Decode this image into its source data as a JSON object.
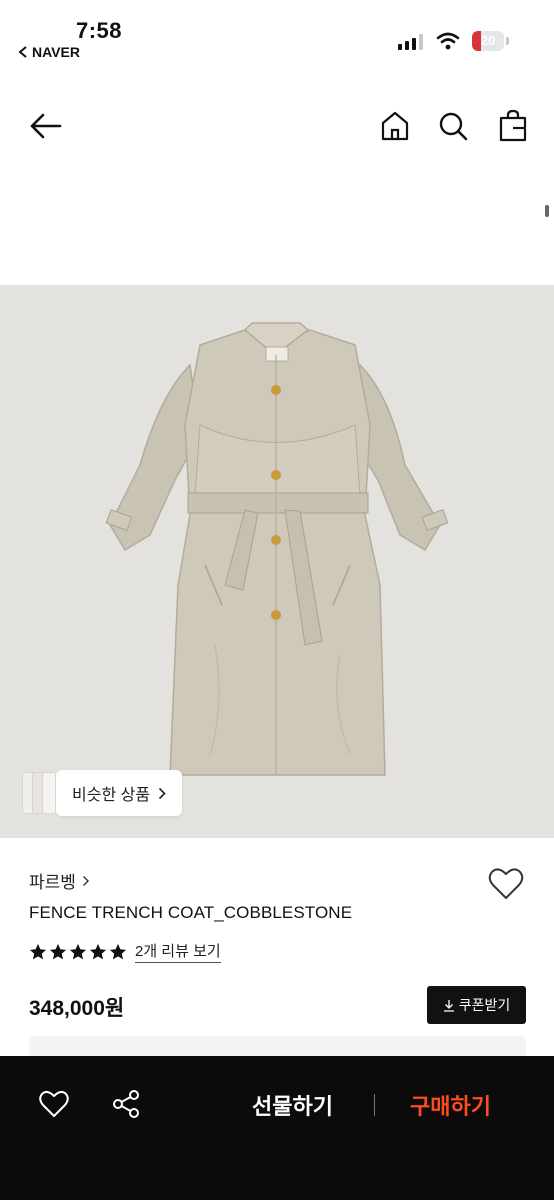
{
  "status_bar": {
    "time": "7:58",
    "back_app": "NAVER",
    "battery": "20"
  },
  "similar": {
    "label": "비슷한 상품"
  },
  "product": {
    "brand": "파르벵",
    "name": "FENCE TRENCH COAT_COBBLESTONE",
    "rating_stars": 5,
    "review_link": "2개 리뷰 보기",
    "price": "348,000원",
    "coupon_label": "쿠폰받기"
  },
  "bottom_bar": {
    "gift_label": "선물하기",
    "buy_label": "구매하기"
  },
  "colors": {
    "buy_accent": "#ff4b1f",
    "bar_bg": "#0b0b0b",
    "image_bg": "#e4e2df",
    "coat": "#cfc9ba"
  }
}
